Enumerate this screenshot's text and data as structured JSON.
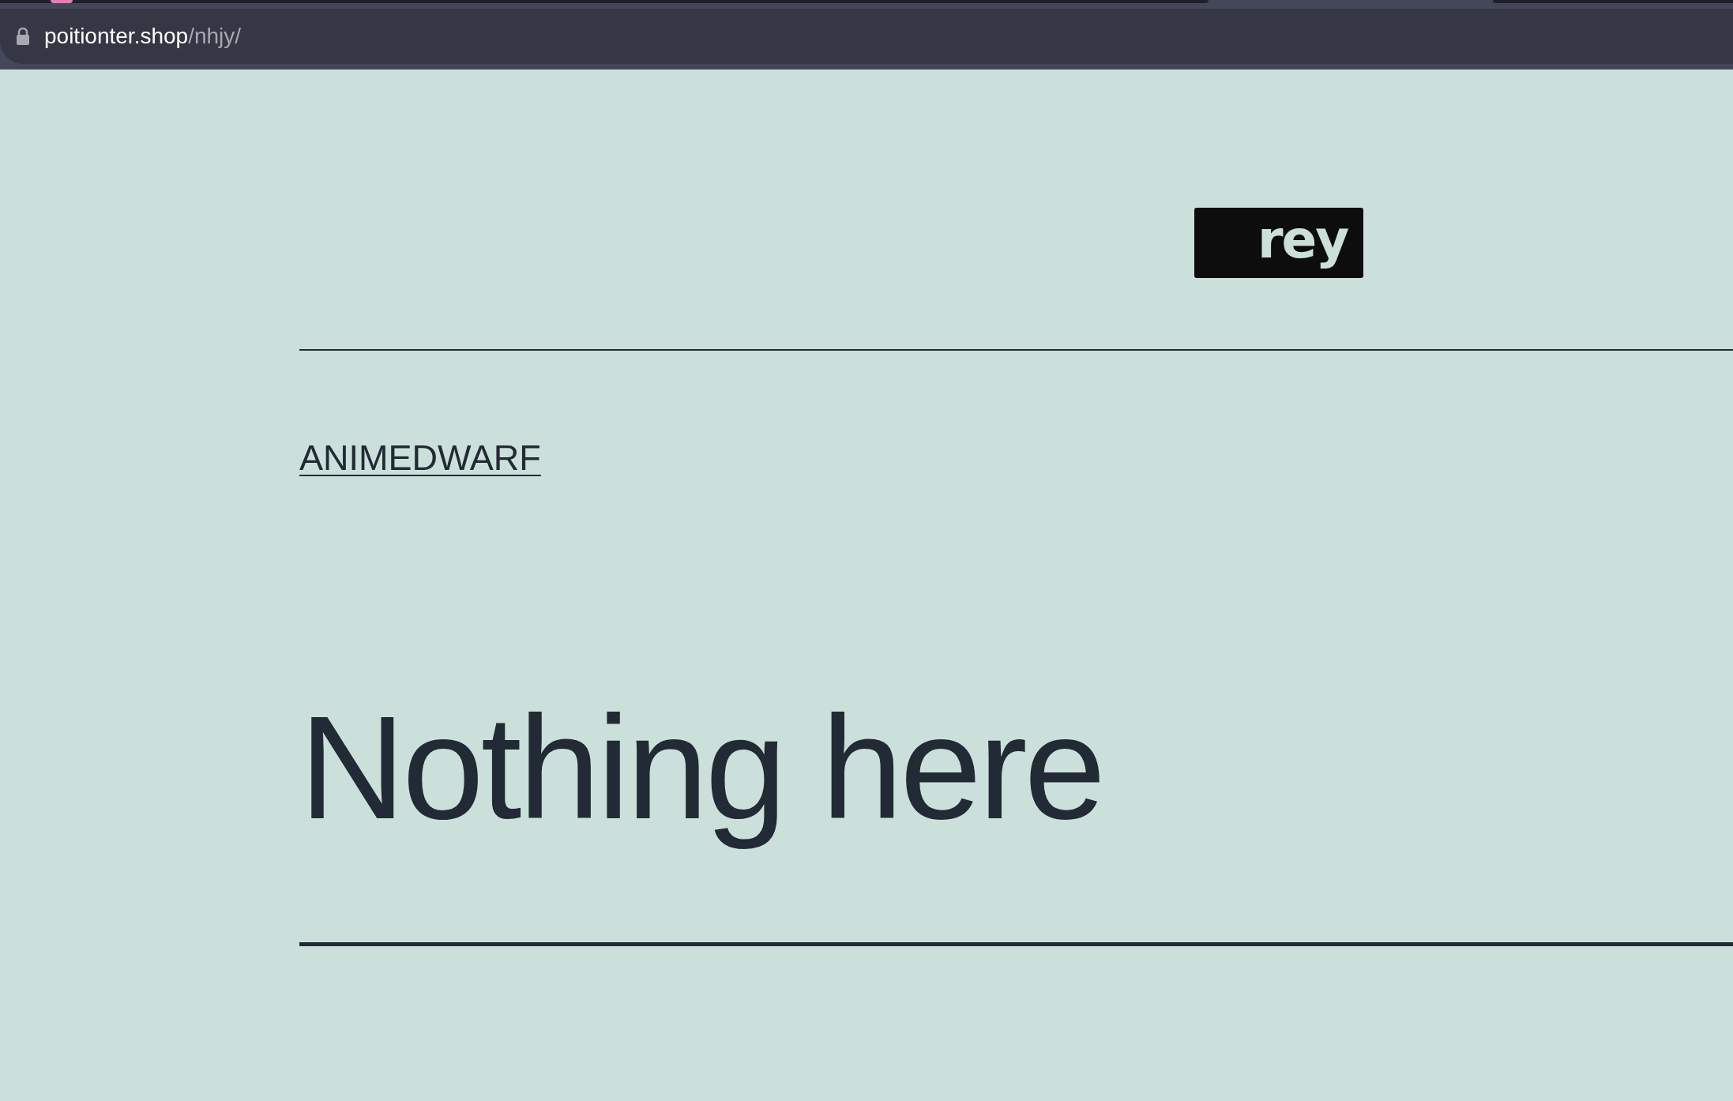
{
  "browser": {
    "url_host": "poitionter.shop",
    "url_path": "/nhjy/"
  },
  "header": {
    "logo": "rey"
  },
  "breadcrumb": "ANIMEDWARF",
  "heading": "Nothing here"
}
